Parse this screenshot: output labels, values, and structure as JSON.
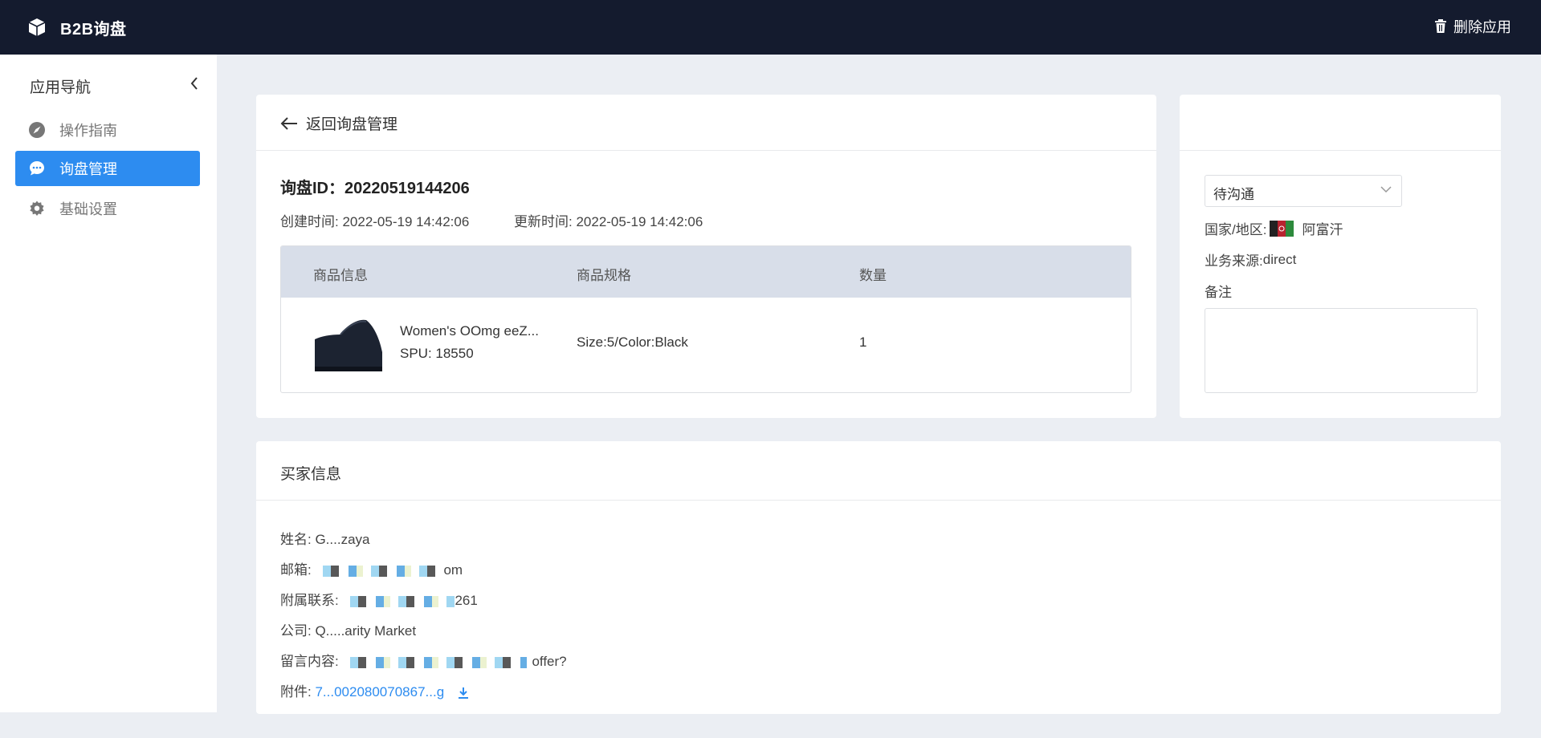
{
  "header": {
    "app_name": "B2B询盘",
    "delete_label": "删除应用"
  },
  "sidebar": {
    "title": "应用导航",
    "items": [
      {
        "label": "操作指南",
        "icon": "compass-icon",
        "active": false
      },
      {
        "label": "询盘管理",
        "icon": "chat-icon",
        "active": true
      },
      {
        "label": "基础设置",
        "icon": "gear-icon",
        "active": false
      }
    ]
  },
  "detail": {
    "back_label": "返回询盘管理",
    "inquiry_id_label": "询盘ID：",
    "inquiry_id": "20220519144206",
    "created_label": "创建时间: ",
    "created_value": "2022-05-19 14:42:06",
    "updated_label": "更新时间: ",
    "updated_value": "2022-05-19 14:42:06",
    "table": {
      "headers": [
        "商品信息",
        "商品规格",
        "数量"
      ],
      "rows": [
        {
          "name": "Women's OOmg eeZ...",
          "spu": "SPU: 18550",
          "spec": "Size:5/Color:Black",
          "qty": "1"
        }
      ]
    }
  },
  "side_panel": {
    "status": "待沟通",
    "country_label": "国家/地区: ",
    "country": "阿富汗",
    "source_label": "业务来源: ",
    "source": "direct",
    "remark_label": "备注"
  },
  "buyer": {
    "title": "买家信息",
    "name_label": "姓名: ",
    "name_value": "G....zaya",
    "email_label": "邮箱: ",
    "email_value": "om",
    "contact_label": "附属联系: ",
    "contact_value": "261",
    "company_label": "公司: ",
    "company_value": "Q.....arity Market",
    "message_label": "留言内容: ",
    "message_value": "offer?",
    "attachment_label": "附件: ",
    "attachment_value": "7...002080070867...g"
  },
  "colors": {
    "topbar": "#141b2e",
    "accent": "#2d8cf0",
    "page_bg": "#ebeef3",
    "table_head": "#d8dee9"
  }
}
